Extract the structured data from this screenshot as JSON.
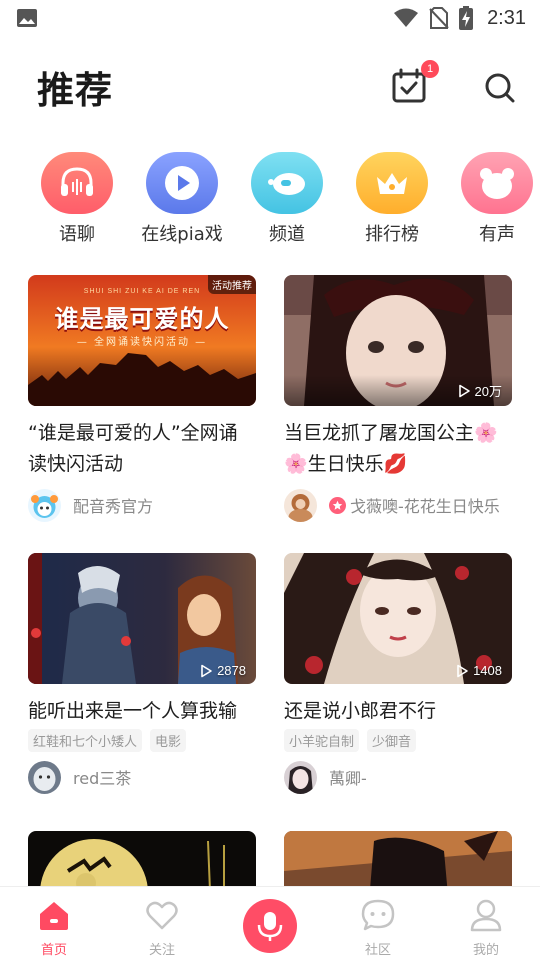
{
  "status_bar": {
    "time": "2:31"
  },
  "header": {
    "title": "推荐",
    "calendar_badge": "1"
  },
  "categories": [
    {
      "label": "语聊",
      "icon": "headphones-icon",
      "color": "#ff6f6f"
    },
    {
      "label": "在线pia戏",
      "icon": "play-circle-icon",
      "color": "#6f8df5"
    },
    {
      "label": "频道",
      "icon": "channel-icon",
      "color": "#5ecde8"
    },
    {
      "label": "排行榜",
      "icon": "crown-icon",
      "color": "#ffc24a"
    },
    {
      "label": "有声",
      "icon": "bear-icon",
      "color": "#ff8aa0"
    }
  ],
  "cards": [
    {
      "title": "“谁是最可爱的人”全网诵读快闪活动",
      "corner_tag": "活动推荐",
      "thumb_title": "谁是最可爱的人",
      "thumb_pinyin": "SHUI SHI ZUI KE AI DE REN",
      "thumb_subtitle": "— 全网诵读快闪活动 —",
      "author": "配音秀官方"
    },
    {
      "title": "当巨龙抓了屠龙国公主🌸🌸生日快乐💋",
      "play_count": "20万",
      "author": "戈薇噢-花花生日快乐"
    },
    {
      "title": "能听出来是一个人算我输",
      "play_count": "2878",
      "tags": [
        "红鞋和七个小矮人",
        "电影"
      ],
      "author": "red三茶"
    },
    {
      "title": "还是说小郎君不行",
      "play_count": "1408",
      "tags": [
        "小羊驼自制",
        "少御音"
      ],
      "author": "萬卿-"
    }
  ],
  "bottom_nav": {
    "home": "首页",
    "follow": "关注",
    "community": "社区",
    "mine": "我的"
  },
  "colors": {
    "accent": "#ff4a62"
  }
}
